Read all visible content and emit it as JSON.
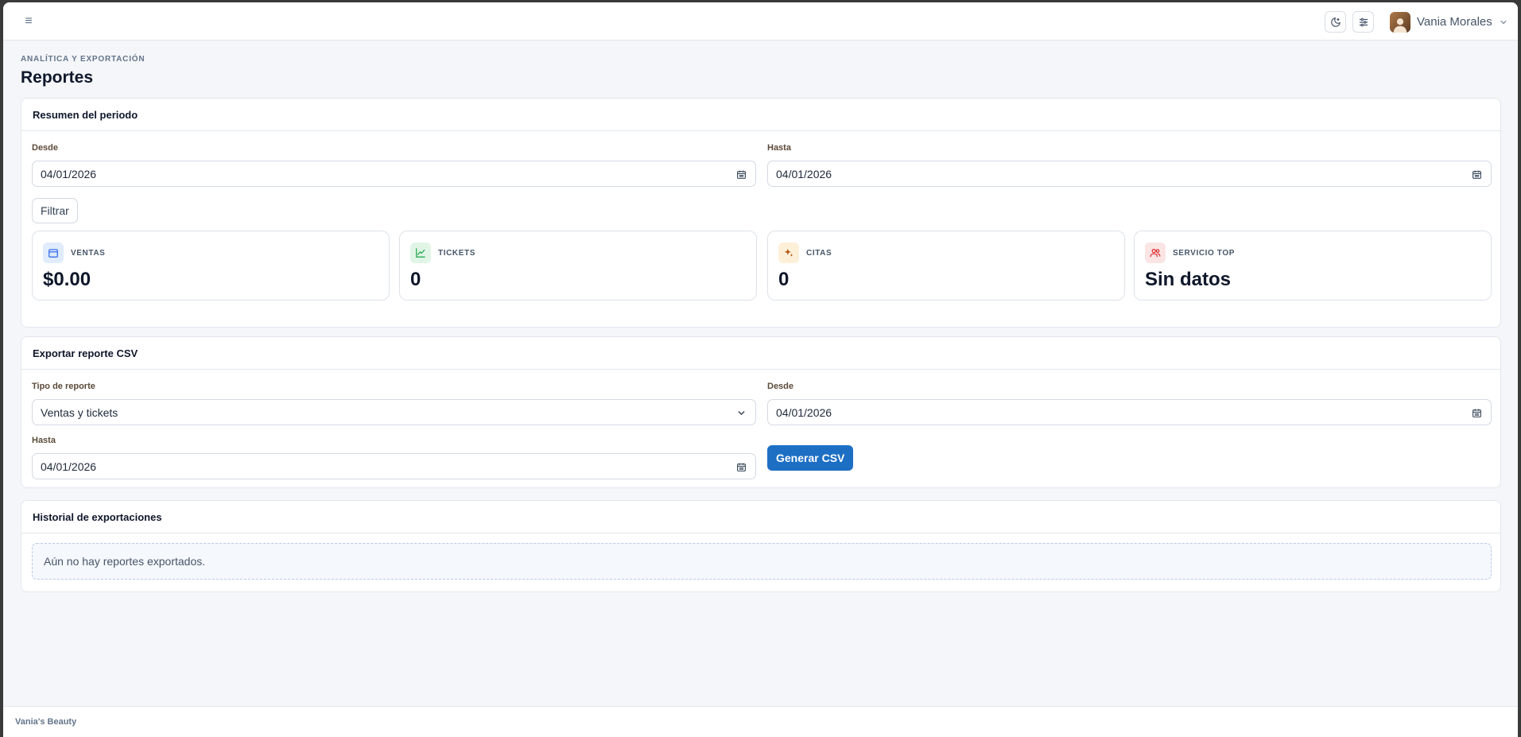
{
  "header": {
    "menu_icon": "hamburger-icon",
    "theme_icon": "moon-icon",
    "settings_icon": "sliders-icon",
    "user_name": "Vania Morales"
  },
  "page": {
    "eyebrow": "ANALÍTICA Y EXPORTACIÓN",
    "title": "Reportes"
  },
  "summary": {
    "title": "Resumen del periodo",
    "from_label": "Desde",
    "from_value": "04/01/2026",
    "to_label": "Hasta",
    "to_value": "04/01/2026",
    "filter_label": "Filtrar",
    "stats": [
      {
        "label": "VENTAS",
        "value": "$0.00",
        "icon": "calendar-icon",
        "color": "#2563eb",
        "bg": "#e0ebfb"
      },
      {
        "label": "TICKETS",
        "value": "0",
        "icon": "trend-up-icon",
        "color": "#16a34a",
        "bg": "#e1f5e6"
      },
      {
        "label": "CITAS",
        "value": "0",
        "icon": "sparkles-icon",
        "color": "#d97706",
        "bg": "#fdf0d8"
      },
      {
        "label": "SERVICIO TOP",
        "value": "Sin datos",
        "icon": "users-icon",
        "color": "#dc2626",
        "bg": "#fbe4e4"
      }
    ]
  },
  "export": {
    "title": "Exportar reporte CSV",
    "type_label": "Tipo de reporte",
    "type_value": "Ventas y tickets",
    "from_label": "Desde",
    "from_value": "04/01/2026",
    "to_label": "Hasta",
    "to_value": "04/01/2026",
    "generate_label": "Generar CSV"
  },
  "history": {
    "title": "Historial de exportaciones",
    "empty_text": "Aún no hay reportes exportados."
  },
  "footer": {
    "brand": "Vania's Beauty"
  },
  "colors": {
    "primary": "#1d6fc4",
    "background": "#f4f6f9"
  }
}
